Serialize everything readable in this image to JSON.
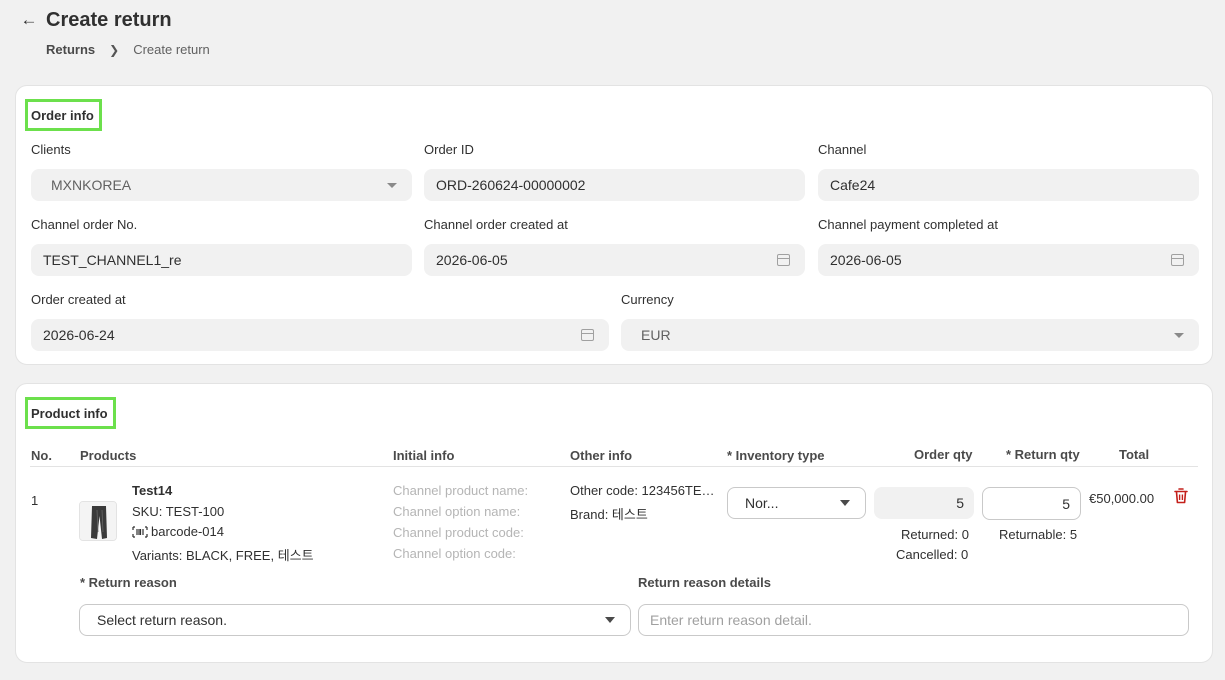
{
  "header": {
    "title": "Create return",
    "breadcrumb": {
      "parent": "Returns",
      "current": "Create return"
    }
  },
  "order_info": {
    "title": "Order info",
    "clients": {
      "label": "Clients",
      "value": "MXNKOREA"
    },
    "order_id": {
      "label": "Order ID",
      "value": "ORD-260624-00000002"
    },
    "channel": {
      "label": "Channel",
      "value": "Cafe24"
    },
    "channel_order_no": {
      "label": "Channel order No.",
      "value": "TEST_CHANNEL1_re"
    },
    "channel_order_created_at": {
      "label": "Channel order created at",
      "value": "2026-06-05"
    },
    "channel_payment_completed_at": {
      "label": "Channel payment completed at",
      "value": "2026-06-05"
    },
    "order_created_at": {
      "label": "Order created at",
      "value": "2026-06-24"
    },
    "currency": {
      "label": "Currency",
      "value": "EUR"
    }
  },
  "product_info": {
    "title": "Product info",
    "columns": {
      "no": "No.",
      "products": "Products",
      "initial_info": "Initial info",
      "other_info": "Other info",
      "inventory_type": "* Inventory type",
      "order_qty": "Order qty",
      "return_qty": "* Return qty",
      "total": "Total"
    },
    "row": {
      "no": "1",
      "name": "Test14",
      "sku": "SKU: TEST-100",
      "barcode": "barcode-014",
      "variants": "Variants: BLACK, FREE, 테스트",
      "initial_labels": [
        "Channel product name:",
        "Channel option name:",
        "Channel product code:",
        "Channel option code:"
      ],
      "other_code": "Other code: 123456TE…",
      "brand": "Brand: 테스트",
      "inventory_type": "Nor...",
      "order_qty": "5",
      "returned": "Returned: 0",
      "cancelled": "Cancelled: 0",
      "return_qty": "5",
      "returnable": "Returnable: 5",
      "total": "€50,000.00"
    },
    "return_reason": {
      "label": "* Return reason",
      "placeholder": "Select return reason."
    },
    "return_reason_details": {
      "label": "Return reason details",
      "placeholder": "Enter return reason detail."
    }
  },
  "colors": {
    "highlight_border": "#6ce04c",
    "delete_icon": "#c4201b"
  }
}
